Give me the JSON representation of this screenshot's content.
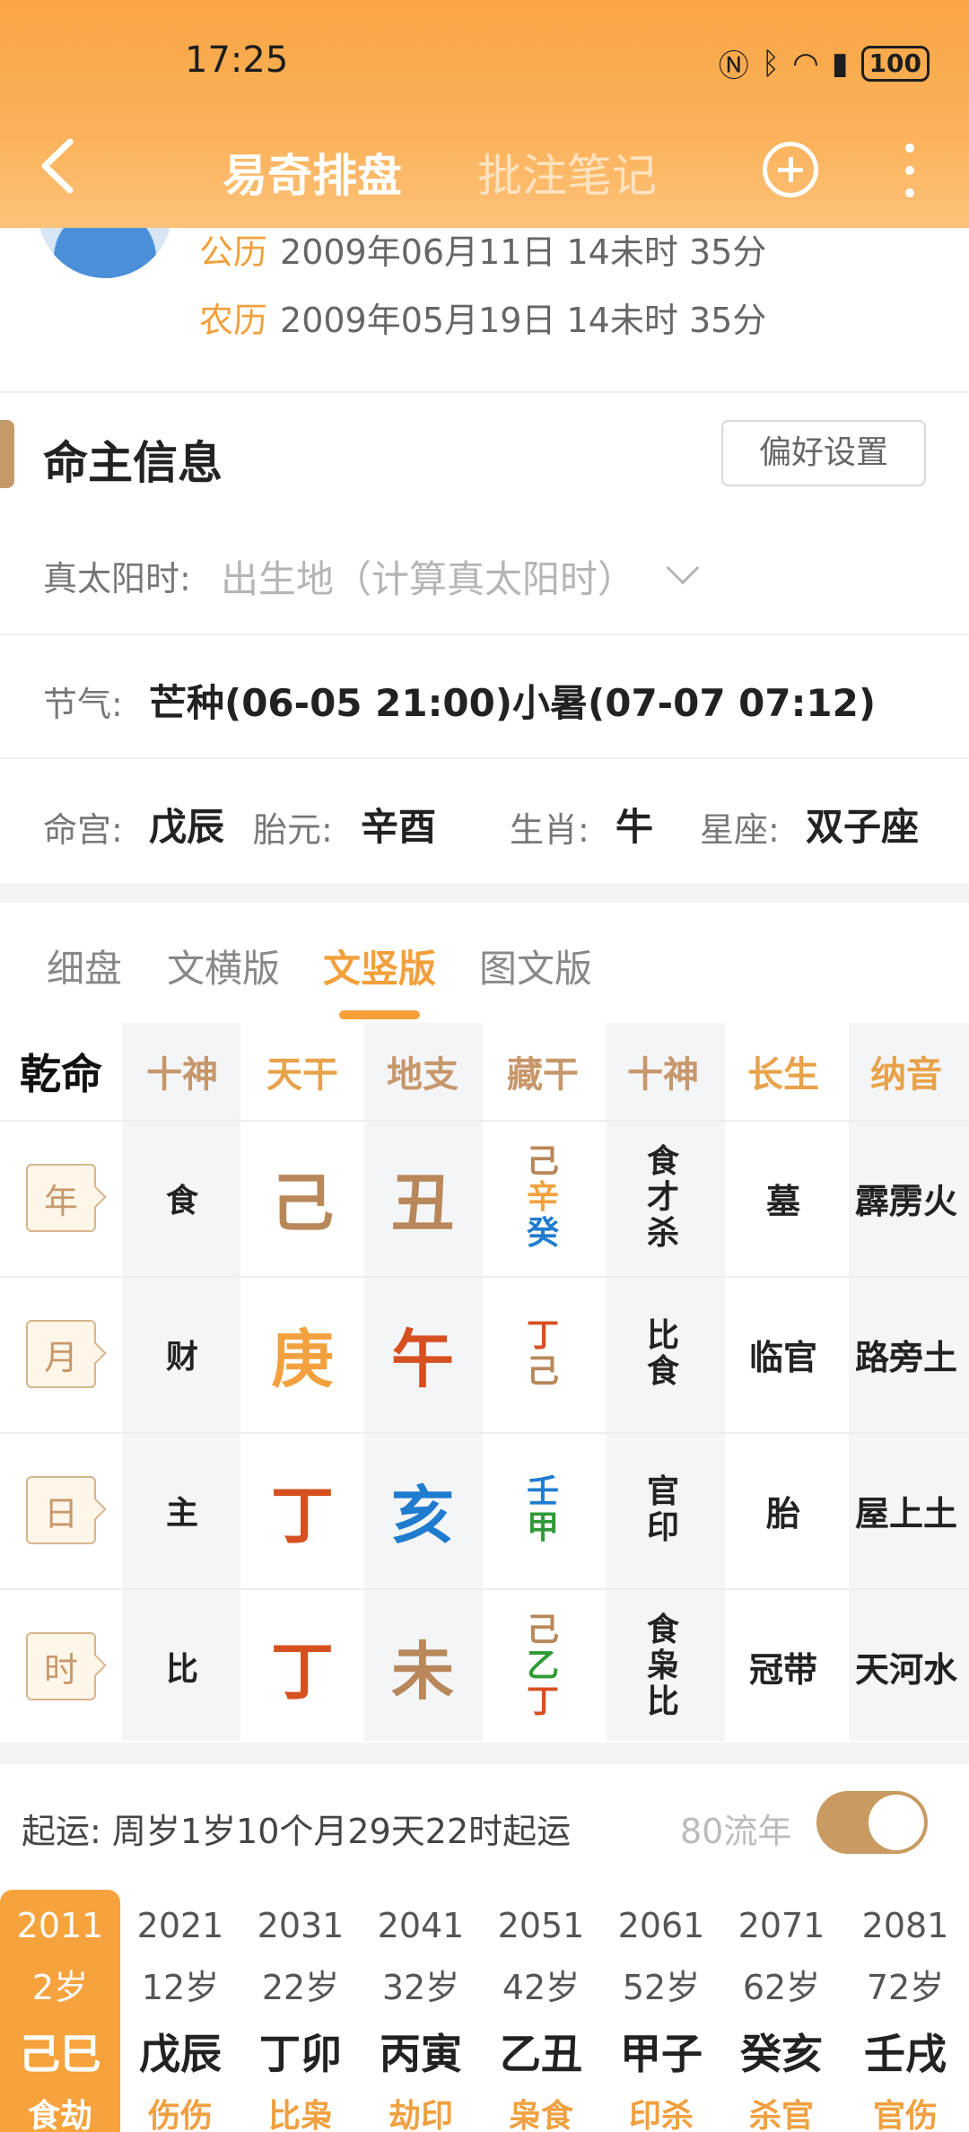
{
  "status": {
    "time": "17:25",
    "icons": [
      "nfc-icon",
      "bluetooth-icon",
      "wifi-icon",
      "5g-signal-icon"
    ],
    "battery": "100"
  },
  "nav": {
    "title": "易奇排盘",
    "tab2": "批注笔记"
  },
  "dates": {
    "solar_label": "公历",
    "solar_value": "2009年06月11日 14未时 35分",
    "lunar_label": "农历",
    "lunar_value": "2009年05月19日 14未时 35分"
  },
  "section": {
    "title": "命主信息",
    "pref_button": "偏好设置"
  },
  "true_solar": {
    "label": "真太阳时:",
    "placeholder": "出生地（计算真太阳时）"
  },
  "jieqi": {
    "label": "节气:",
    "value": "芒种(06-05 21:00)小暑(07-07 07:12)"
  },
  "details": {
    "minggong_label": "命宫:",
    "minggong": "戊辰",
    "taiyuan_label": "胎元:",
    "taiyuan": "辛酉",
    "shengxiao_label": "生肖:",
    "shengxiao": "牛",
    "xingzuo_label": "星座:",
    "xingzuo": "双子座"
  },
  "view_tabs": [
    "细盘",
    "文横版",
    "文竖版",
    "图文版"
  ],
  "chart": {
    "headers": [
      "乾命",
      "十神",
      "天干",
      "地支",
      "藏干",
      "十神",
      "长生",
      "纳音"
    ],
    "rows": [
      {
        "tag": "年",
        "shishen": "食",
        "tiangan": "己",
        "dizhi": "丑",
        "canggan": [
          "己",
          "辛",
          "癸"
        ],
        "shishen2": [
          "食",
          "才",
          "杀"
        ],
        "changsheng": "墓",
        "nayin": "霹雳火"
      },
      {
        "tag": "月",
        "shishen": "财",
        "tiangan": "庚",
        "dizhi": "午",
        "canggan": [
          "丁",
          "己"
        ],
        "shishen2": [
          "比",
          "食"
        ],
        "changsheng": "临官",
        "nayin": "路旁土"
      },
      {
        "tag": "日",
        "shishen": "主",
        "tiangan": "丁",
        "dizhi": "亥",
        "canggan": [
          "壬",
          "甲"
        ],
        "shishen2": [
          "官",
          "印"
        ],
        "changsheng": "胎",
        "nayin": "屋上土"
      },
      {
        "tag": "时",
        "shishen": "比",
        "tiangan": "丁",
        "dizhi": "未",
        "canggan": [
          "己",
          "乙",
          "丁"
        ],
        "shishen2": [
          "食",
          "枭",
          "比"
        ],
        "changsheng": "冠带",
        "nayin": "天河水"
      }
    ],
    "colors": {
      "earth": "#b8875a",
      "metal": "#f2a13e",
      "fire": "#d6501f",
      "water": "#1f7ccf",
      "wood": "#2f9b36"
    }
  },
  "qiyun": {
    "label": "起运:  周岁1岁10个月29天22时起运",
    "flow": "80流年"
  },
  "dayun": [
    {
      "year": "2011",
      "age": "2岁",
      "gz": "己巳",
      "ss": "食劫"
    },
    {
      "year": "2021",
      "age": "12岁",
      "gz": "戊辰",
      "ss": "伤伤"
    },
    {
      "year": "2031",
      "age": "22岁",
      "gz": "丁卯",
      "ss": "比枭"
    },
    {
      "year": "2041",
      "age": "32岁",
      "gz": "丙寅",
      "ss": "劫印"
    },
    {
      "year": "2051",
      "age": "42岁",
      "gz": "乙丑",
      "ss": "枭食"
    },
    {
      "year": "2061",
      "age": "52岁",
      "gz": "甲子",
      "ss": "印杀"
    },
    {
      "year": "2071",
      "age": "62岁",
      "gz": "癸亥",
      "ss": "杀官"
    },
    {
      "year": "2081",
      "age": "72岁",
      "gz": "壬戌",
      "ss": "官伤"
    }
  ]
}
